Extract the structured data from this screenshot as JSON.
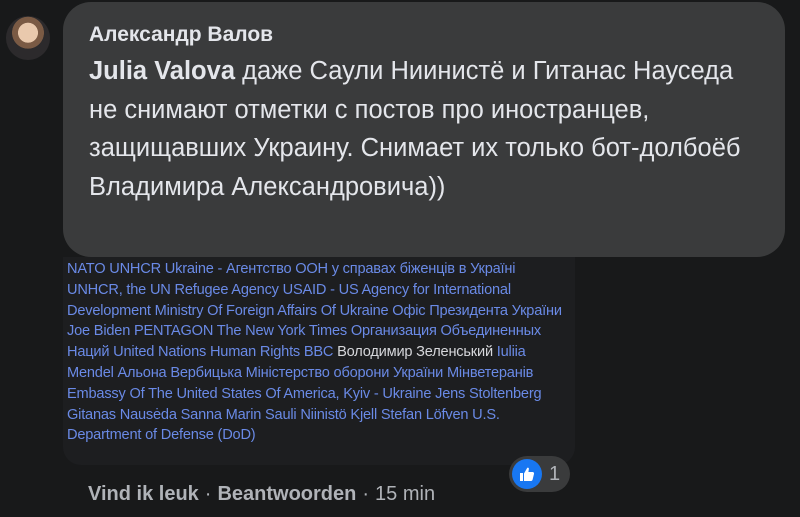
{
  "comment": {
    "author": "Александр Валов",
    "mention": "Julia Valova",
    "text": " даже Саули Ниинистё и Гитанас Науседа не снимают отметки с постов про иностранцев, защищавших Украину. Снимает их только бот-долбоёб Владимира Александровича))"
  },
  "preview": {
    "part1": "NATO UNHCR Ukraine - Агентство ООН у справах біженців в Україні UNHCR, the UN Refugee Agency USAID - US Agency for International Development Ministry Of Foreign Affairs Of Ukraine Офіс Президента України Joe Biden PENTAGON The New York Times Организация Объединенных Наций United Nations Human Rights BBC ",
    "highlight": "Володимир Зеленський",
    "part2": " Iuliia Mendel Альона Вербицька Міністерство оборони України Мінветеранів Embassy Of The United States Of America, Kyiv - Ukraine Jens Stoltenberg Gitanas Nausėda Sanna Marin Sauli Niinistö Kjell Stefan Löfven U.S. Department of Defense (DoD)"
  },
  "reactions": {
    "count": "1",
    "icon": "thumbs-up-icon",
    "color": "#1877f2"
  },
  "actions": {
    "like": "Vind ik leuk",
    "separator": "·",
    "reply": "Beantwoorden",
    "time": "15 min"
  }
}
